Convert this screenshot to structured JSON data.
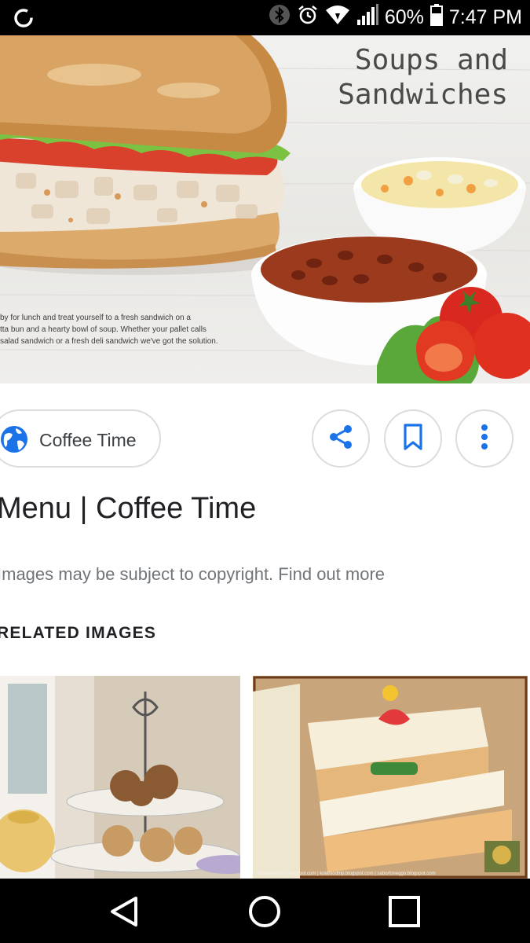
{
  "status_bar": {
    "battery_percent": "60%",
    "time": "7:47 PM",
    "icons": [
      "sync-icon",
      "bluetooth-icon",
      "alarm-icon",
      "wifi-icon",
      "signal-icon",
      "battery-icon"
    ]
  },
  "hero": {
    "title_line1": "Soups and",
    "title_line2": "Sandwiches",
    "caption_line1": "by for lunch and treat yourself to a fresh sandwich on a",
    "caption_line2": "tta bun and a hearty bowl of soup. Whether your pallet calls",
    "caption_line3": "salad sandwich or a fresh deli sandwich we've got the solution."
  },
  "source": {
    "label": "Coffee Time",
    "icon": "globe-icon"
  },
  "actions": {
    "share_icon": "share-icon",
    "save_icon": "bookmark-icon",
    "more_icon": "more-vertical-icon"
  },
  "page_title": "Menu | Coffee Time",
  "copyright_text": "Images may be subject to copyright. Find out more",
  "related_heading": "RELATED IMAGES",
  "related_images": {
    "second_credit": "flavoursofcoin.blogspot.com | kolafoodtrip.blogspot.com | saborfoneggo.blogspot.com"
  },
  "nav_bar": {
    "icons": [
      "back-icon",
      "home-icon",
      "recent-apps-icon"
    ]
  },
  "colors": {
    "accent_blue": "#1a73e8",
    "chip_border": "#dadce0",
    "secondary_text": "#70757a"
  }
}
